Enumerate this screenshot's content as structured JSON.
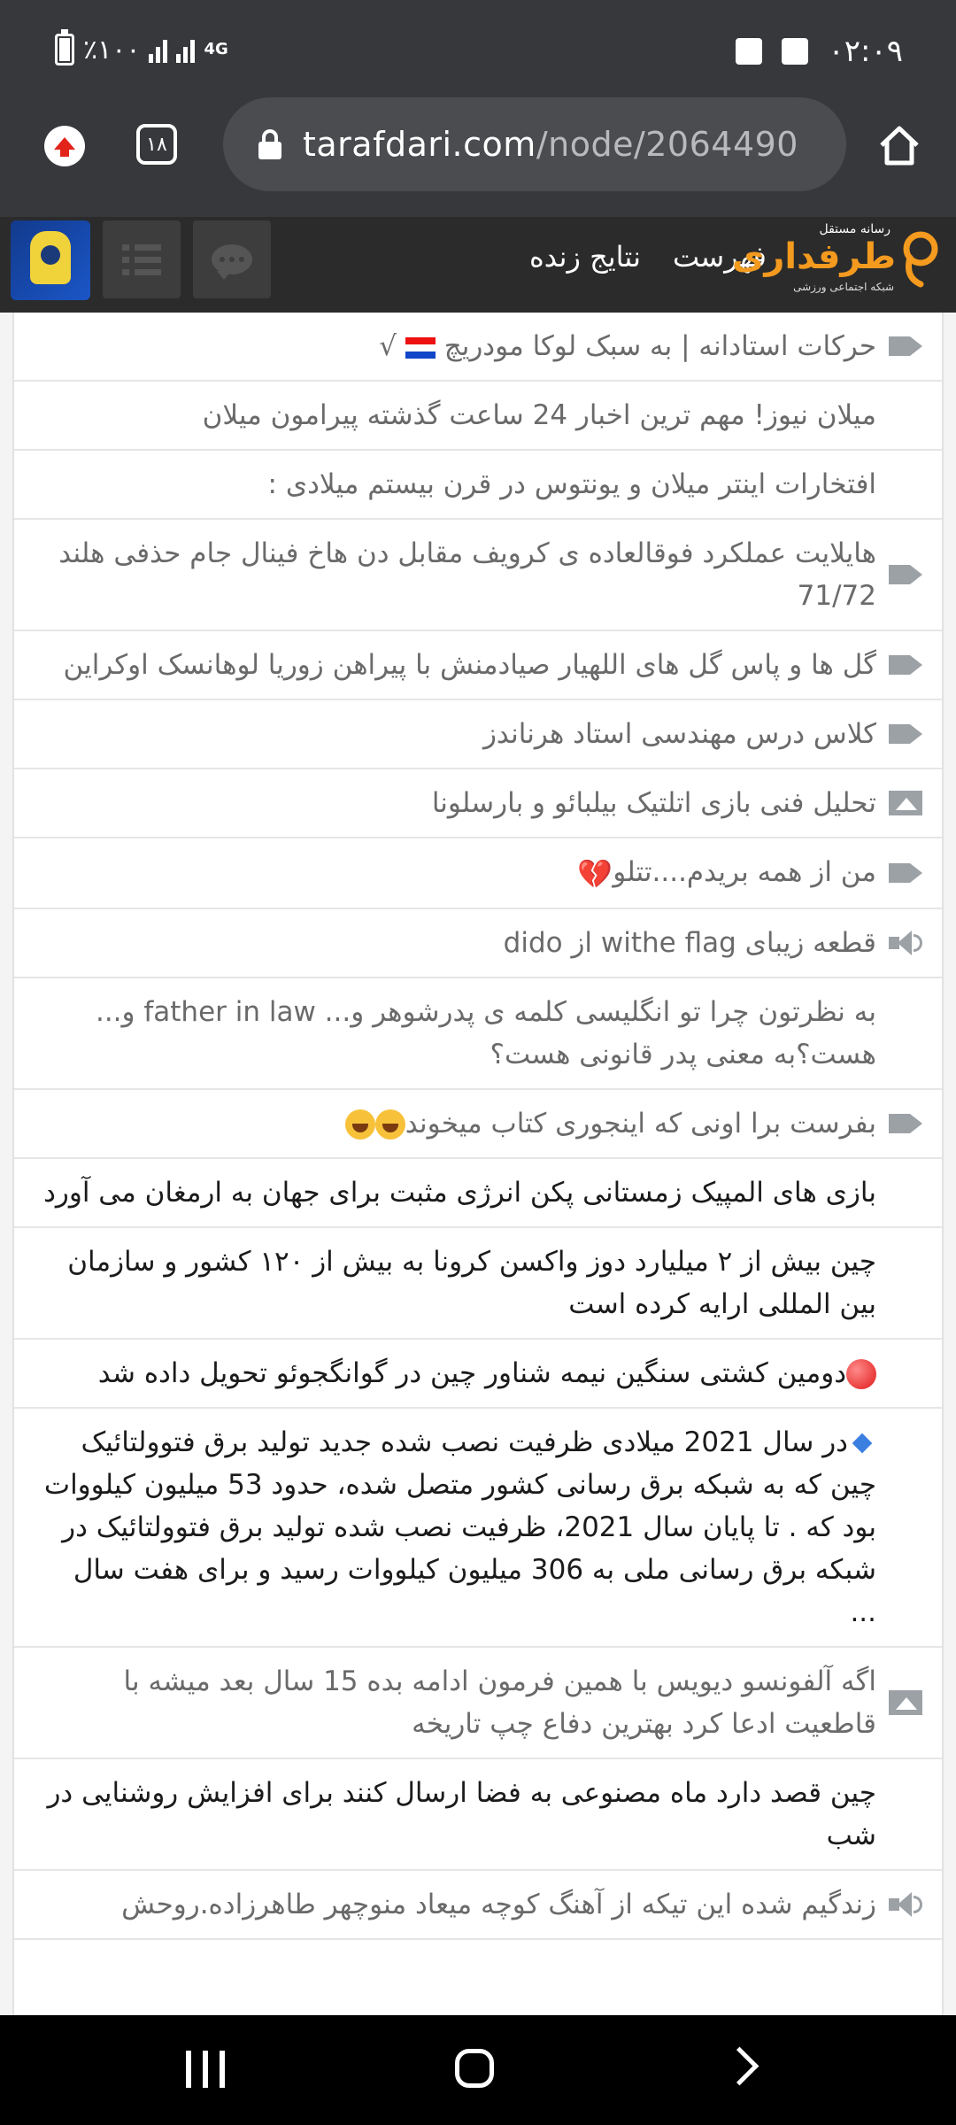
{
  "status": {
    "time": "۰۲:۰۹",
    "battery": "٪۱۰۰",
    "network": "4G"
  },
  "browser": {
    "url_host": "tarafdari.com",
    "url_path": "/node/2064490",
    "tab_count": "۱۸"
  },
  "site": {
    "tagline_top": "رسانه مستقل",
    "name": "طرفداری",
    "tagline_bottom": "شبکه اجتماعی ورزشی",
    "nav_list": "فهرست",
    "nav_live": "نتایج زنده"
  },
  "posts": [
    {
      "title": "حرکات استادانه | به سبک لوکا مودریچ",
      "icon": "video-icon",
      "bold": false,
      "suffix": "flag-check"
    },
    {
      "title": "میلان نیوز! مهم ترین اخبار 24 ساعت گذشته پیرامون میلان",
      "icon": "",
      "bold": false
    },
    {
      "title": "افتخارات اینتر میلان و یونتوس در قرن بیستم میلادی :",
      "icon": "",
      "bold": false
    },
    {
      "title": "هایلایت عملکرد فوقالعاده ی کرویف مقابل دن هاخ فینال جام حذفی هلند 71/72",
      "icon": "video-icon",
      "bold": false
    },
    {
      "title": "گل ها و پاس گل های اللهیار صیادمنش با پیراهن زوریا لوهانسک اوکراین",
      "icon": "video-icon",
      "bold": false
    },
    {
      "title": "کلاس درس مهندسی استاد هرناندز",
      "icon": "video-icon",
      "bold": false
    },
    {
      "title": "تحلیل فنی بازی اتلتیک بیلبائو و بارسلونا",
      "icon": "image-icon",
      "bold": false
    },
    {
      "title": "من از همه بریدم....تتلو",
      "icon": "video-icon",
      "bold": false,
      "suffix": "heart"
    },
    {
      "title": "قطعه زیبای withe flag از dido",
      "icon": "audio-icon",
      "bold": false
    },
    {
      "title": "به نظرتون چرا تو انگلیسی کلمه ی پدرشوهر و... father in law و... هست؟به معنی پدر قانونی هست؟",
      "icon": "",
      "bold": false
    },
    {
      "title": "بفرست برا اونی که اینجوری کتاب میخوند",
      "icon": "video-icon",
      "bold": false,
      "suffix": "laugh"
    },
    {
      "title": "بازی های المپیک زمستانی پکن انرژی مثبت برای جهان به ارمغان می آورد",
      "icon": "",
      "bold": true
    },
    {
      "title": "چین بیش از ۲ میلیارد دوز واکسن کرونا به بیش از ۱۲۰ کشور و سازمان بین المللی ارایه کرده است",
      "icon": "",
      "bold": true
    },
    {
      "title": "دومین کشتی سنگین نیمه شناور چین در گوانگجوئو تحویل داده شد",
      "icon": "",
      "bold": true,
      "prefix": "red-dot"
    },
    {
      "title": "در سال 2021 میلادی ظرفیت نصب شده جدید تولید برق فتوولتائیک چین که به شبکه برق رسانی کشور متصل شده، حدود 53 میلیون کیلووات بود که . تا پایان سال 2021، ظرفیت نصب شده تولید برق فتوولتائیک در شبکه برق رسانی ملی به 306 میلیون کیلووات رسید و برای هفت سال ...",
      "icon": "",
      "bold": true,
      "prefix": "diamond"
    },
    {
      "title": "اگه آلفونسو دیویس با همین فرمون ادامه بده 15 سال بعد میشه با قاطعیت ادعا کرد بهترین دفاع چپ تاریخه",
      "icon": "image-icon",
      "bold": false
    },
    {
      "title": "چین قصد دارد ماه مصنوعی به فضا ارسال کنند برای افزایش روشنایی در شب",
      "icon": "",
      "bold": true
    },
    {
      "title": "زندگیم شده این تیکه از آهنگ کوچه میعاد منوچهر طاهرزاده.روحش",
      "icon": "audio-icon",
      "bold": false
    }
  ]
}
